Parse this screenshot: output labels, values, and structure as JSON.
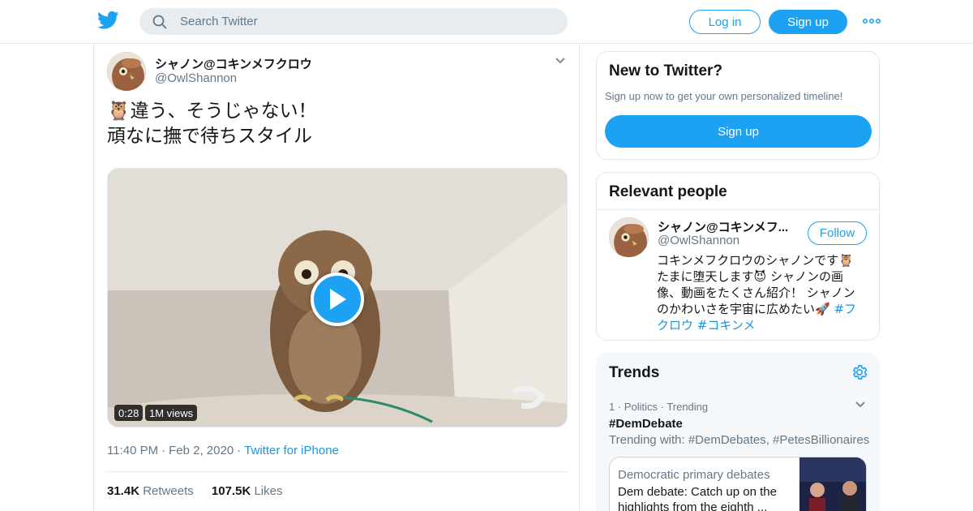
{
  "header": {
    "search_placeholder": "Search Twitter",
    "login_label": "Log in",
    "signup_label": "Sign up",
    "brand_color": "#1da1f2"
  },
  "tweet": {
    "author_name": "シャノン@コキンメフクロウ",
    "author_handle": "@OwlShannon",
    "text_line1": "🦉違う、そうじゃない！",
    "text_line2": "頑なに撫で待ちスタイル",
    "video_duration": "0:28",
    "video_views": "1M views",
    "time": "11:40 PM",
    "date": "Feb 2, 2020",
    "source": "Twitter for iPhone",
    "retweets_count": "31.4K",
    "retweets_label": "Retweets",
    "likes_count": "107.5K",
    "likes_label": "Likes"
  },
  "new_to_twitter": {
    "title": "New to Twitter?",
    "subtitle": "Sign up now to get your own personalized timeline!",
    "button_label": "Sign up"
  },
  "relevant_people": {
    "title": "Relevant people",
    "name": "シャノン@コキンメフ...",
    "handle": "@OwlShannon",
    "follow_label": "Follow",
    "bio_text": "コキンメフクロウのシャノンです🦉たまに堕天します😈 シャノンの画像、動画をたくさん紹介！ シャノンのかわいさを宇宙に広めたい🚀 ",
    "bio_tag1": "#フクロウ",
    "bio_tag2": "#コキンメ"
  },
  "trends": {
    "title": "Trends",
    "items": [
      {
        "rank": "1",
        "category": "Politics",
        "status": "Trending",
        "name": "#DemDebate",
        "trending_with": "Trending with: #DemDebates, #PetesBillionaires"
      }
    ],
    "news": {
      "title": "Democratic primary debates",
      "body": "Dem debate: Catch up on the highlights from the eighth ..."
    }
  }
}
